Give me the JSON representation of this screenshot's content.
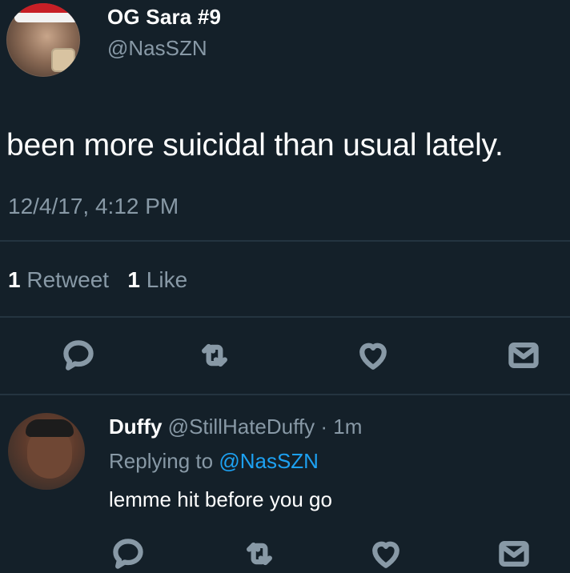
{
  "tweet": {
    "display_name": "OG Sara #9",
    "handle": "@NasSZN",
    "text": "been more suicidal than usual lately.",
    "timestamp": "12/4/17, 4:12 PM",
    "retweet_count": "1",
    "retweet_label": "Retweet",
    "like_count": "1",
    "like_label": "Like",
    "actions": [
      "reply-icon",
      "retweet-icon",
      "like-icon",
      "direct-message-icon"
    ]
  },
  "reply": {
    "display_name": "Duffy",
    "handle": "@StillHateDuffy",
    "separator": "·",
    "age": "1m",
    "replying_to_prefix": "Replying to",
    "replying_to_handle": "@NasSZN",
    "text": "lemme hit before you go"
  },
  "colors": {
    "background": "#142029",
    "secondary_text": "#8899a6",
    "link": "#1da1f2",
    "divider": "#243440"
  }
}
